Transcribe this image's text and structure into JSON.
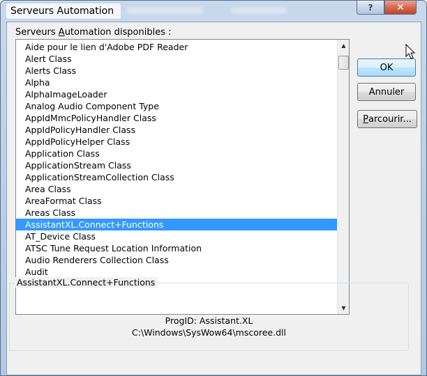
{
  "window": {
    "title": "Serveurs Automation",
    "help_label": "?",
    "close_label": "✕"
  },
  "list": {
    "label_before": "Serveurs ",
    "label_access": "A",
    "label_after": "utomation disponibles :",
    "items": [
      "Aide pour le lien d'Adobe PDF Reader",
      "Alert Class",
      "Alerts Class",
      "Alpha",
      "AlphaImageLoader",
      "Analog Audio Component Type",
      "AppIdMmcPolicyHandler Class",
      "AppIdPolicyHandler Class",
      "AppIdPolicyHelper Class",
      "Application Class",
      "ApplicationStream Class",
      "ApplicationStreamCollection Class",
      "Area Class",
      "AreaFormat Class",
      "Areas Class",
      "AssistantXL.Connect+Functions",
      "AT_Device Class",
      "ATSC Tune Request Location Information",
      "Audio Renderers Collection Class",
      "Audit"
    ],
    "selected_index": 15
  },
  "buttons": {
    "ok": "OK",
    "annuler": "Annuler",
    "parcourir_access": "P",
    "parcourir_rest": "arcourir..."
  },
  "info": {
    "title": "AssistantXL.Connect+Functions",
    "progid": "ProgID: Assistant.XL",
    "path": "C:\\Windows\\SysWow64\\mscoree.dll"
  },
  "colors": {
    "selection": "#3399ff",
    "close_button": "#c2412a"
  }
}
